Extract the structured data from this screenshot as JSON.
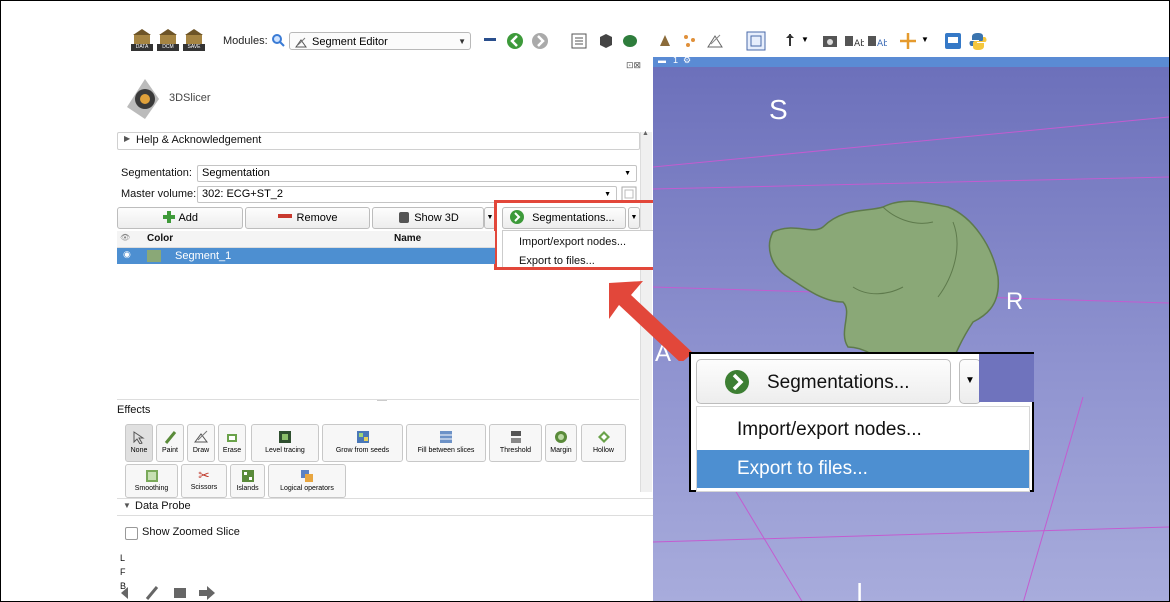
{
  "toolbar": {
    "data_label": "DATA",
    "dcm_label": "DCM",
    "save_label": "SAVE",
    "modules_label": "Modules:",
    "module_selected": "Segment Editor"
  },
  "logo": {
    "text": "3DSlicer"
  },
  "help": {
    "label": "Help & Acknowledgement"
  },
  "segmentation": {
    "label": "Segmentation:",
    "value": "Segmentation"
  },
  "master_volume": {
    "label": "Master volume:",
    "value": "302: ECG+ST_2"
  },
  "buttons": {
    "add": "Add",
    "remove": "Remove",
    "show3d": "Show 3D",
    "segmentations": "Segmentations..."
  },
  "dropdown": {
    "import_export": "Import/export nodes...",
    "export_files": "Export to files..."
  },
  "table": {
    "col_color": "Color",
    "col_name": "Name",
    "row_name": "Segment_1"
  },
  "effects": {
    "title": "Effects",
    "items": [
      "None",
      "Paint",
      "Draw",
      "Erase",
      "Level tracing",
      "Grow from seeds",
      "Fill between slices",
      "Threshold",
      "Margin",
      "Hollow"
    ],
    "items2": [
      "Smoothing",
      "Scissors",
      "Islands",
      "Logical operators"
    ]
  },
  "data_probe": {
    "title": "Data Probe",
    "show_zoomed": "Show Zoomed Slice",
    "L": "L",
    "F": "F",
    "B": "B"
  },
  "view": {
    "label_S": "S",
    "label_R": "R",
    "label_A": "A",
    "label_I": "I",
    "tab": "1"
  },
  "colors": {
    "highlight": "#e2473a",
    "selection": "#4d8fd1",
    "segment": "#8aa877",
    "view_bg": "#7d81c5"
  }
}
